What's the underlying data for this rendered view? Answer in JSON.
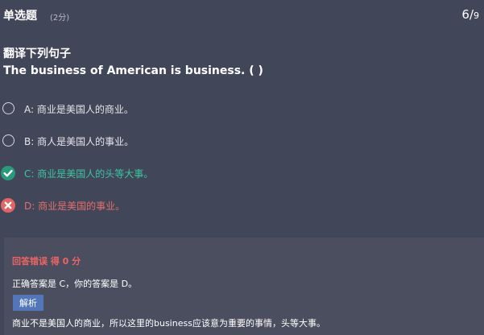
{
  "header": {
    "question_type": "单选题",
    "points": "(2分)",
    "progress_current": "6",
    "progress_separator": "/",
    "progress_total": "9"
  },
  "question": {
    "title": "翻译下列句子",
    "sentence": "The business of American is business. ( )"
  },
  "options": [
    {
      "text": "A: 商业是美国人的商业。",
      "state": "unselected"
    },
    {
      "text": "B: 商人是美国人的事业。",
      "state": "unselected"
    },
    {
      "text": "C: 商业是美国人的头等大事。",
      "state": "correct"
    },
    {
      "text": "D: 商业是美国的事业。",
      "state": "wrong"
    }
  ],
  "feedback": {
    "verdict": "回答错误 得 0 分",
    "answer_line": "正确答案是 C，你的答案是 D。",
    "explain_label": "解析",
    "explanation": "商业不是美国人的商业，所以这里的business应该意为重要的事情，头等大事。"
  },
  "colors": {
    "background": "#414658",
    "correct": "#3cc5a2",
    "wrong": "#e46e6e",
    "verdict": "#ee6464",
    "badge": "#5276b8",
    "panel": "#4a4e5e"
  },
  "icons": {
    "unselected": "radio-circle-icon",
    "correct": "check-circle-icon",
    "wrong": "x-circle-icon"
  }
}
